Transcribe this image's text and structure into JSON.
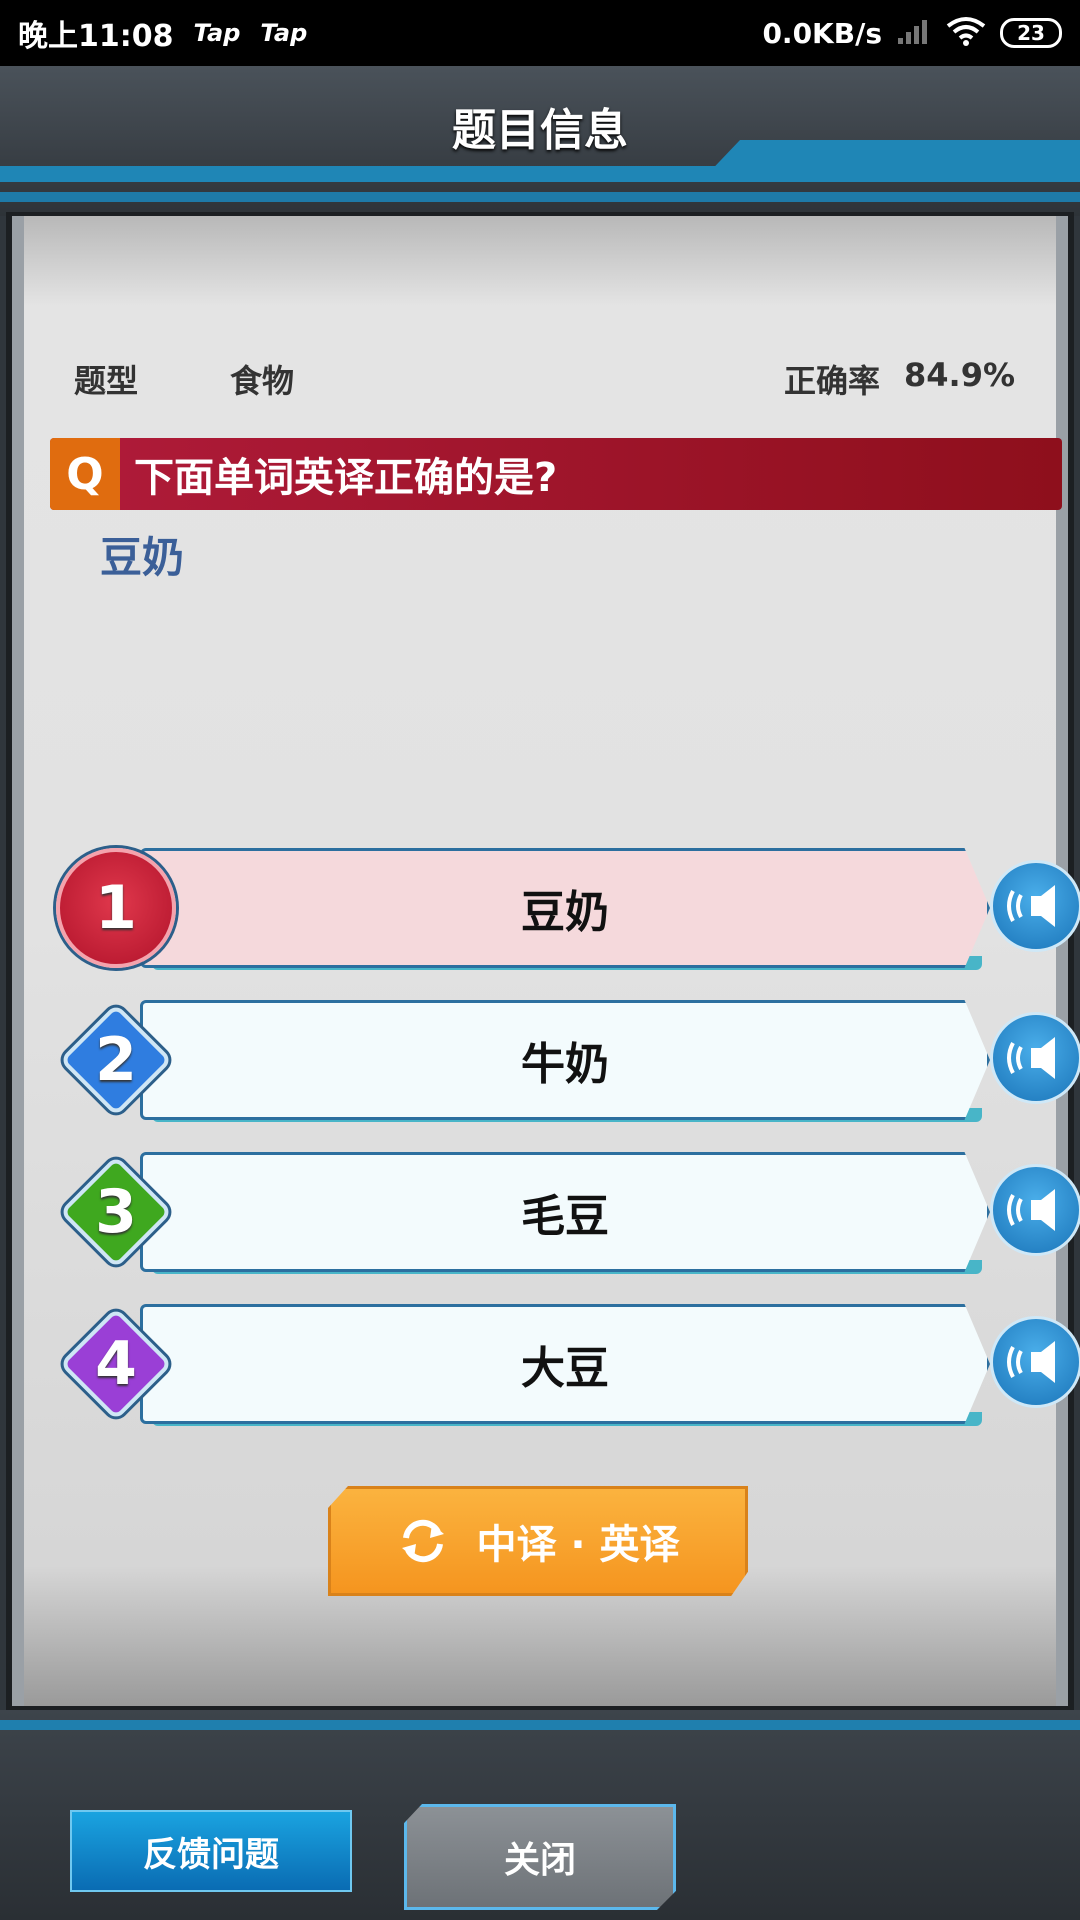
{
  "status_bar": {
    "time": "晚上11:08",
    "apps": [
      "Tap",
      "Tap"
    ],
    "network_speed": "0.0KB/s",
    "battery": "23"
  },
  "header": {
    "title": "题目信息"
  },
  "meta": {
    "type_label": "题型",
    "type_value": "食物",
    "rate_label": "正确率",
    "rate_value": "84.9%"
  },
  "question": {
    "icon": "Q",
    "text": "下面单词英译正确的是?",
    "word": "豆奶"
  },
  "options": [
    {
      "num": "1",
      "label": "豆奶",
      "state": "selected",
      "color": "#c9203a"
    },
    {
      "num": "2",
      "label": "牛奶",
      "state": "normal",
      "color": "#2f7de0"
    },
    {
      "num": "3",
      "label": "毛豆",
      "state": "normal",
      "color": "#3fa81f"
    },
    {
      "num": "4",
      "label": "大豆",
      "state": "normal",
      "color": "#9a3fd6"
    }
  ],
  "toggle_button": {
    "label": "中译 · 英译"
  },
  "footer": {
    "feedback_label": "反馈问题",
    "close_label": "关闭"
  },
  "colors": {
    "selected_bg": "#f5d9dc",
    "normal_bg": "#f3fbfd",
    "accent": "#1f86b6"
  }
}
